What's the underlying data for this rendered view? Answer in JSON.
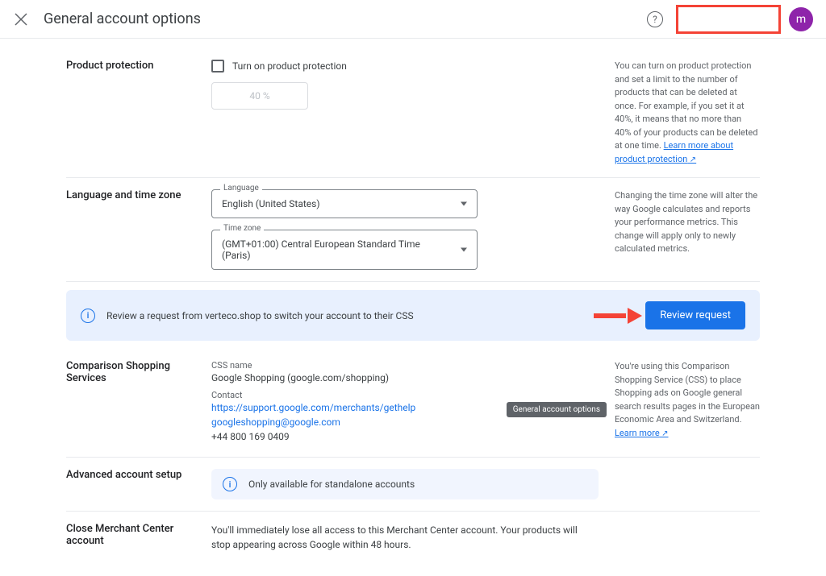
{
  "header": {
    "title": "General account options",
    "avatar_letter": "m"
  },
  "product_protection": {
    "label": "Product protection",
    "checkbox_label": "Turn on product protection",
    "percent_placeholder": "40 %",
    "side_text": "You can turn on product protection and set a limit to the number of products that can be deleted at once. For example, if you set it at 40%, it means that no more than 40% of your products can be deleted at one time.",
    "side_link": "Learn more about product protection"
  },
  "language_tz": {
    "label": "Language and time zone",
    "language_label": "Language",
    "language_value": "English (United States)",
    "timezone_label": "Time zone",
    "timezone_value": "(GMT+01:00) Central European Standard Time (Paris)",
    "side_text": "Changing the time zone will alter the way Google calculates and reports your performance metrics. This change will apply only to newly calculated metrics."
  },
  "review_banner": {
    "text": "Review a request from verteco.shop to switch your account to their CSS",
    "button": "Review request"
  },
  "css": {
    "label": "Comparison Shopping Services",
    "name_label": "CSS name",
    "name_value": "Google Shopping (google.com/shopping)",
    "contact_label": "Contact",
    "contact_url": "https://support.google.com/merchants/gethelp",
    "contact_email": "googleshopping@google.com",
    "contact_phone": "+44 800 169 0409",
    "side_text": "You're using this Comparison Shopping Service (CSS) to place Shopping ads on Google general search results pages in the European Economic Area and Switzerland.",
    "side_link": "Learn more",
    "tooltip_text": "General account options"
  },
  "advanced": {
    "label": "Advanced account setup",
    "banner_text": "Only available for standalone accounts"
  },
  "close_account": {
    "label": "Close Merchant Center account",
    "text": "You'll immediately lose all access to this Merchant Center account. Your products will stop appearing across Google within 48 hours."
  }
}
